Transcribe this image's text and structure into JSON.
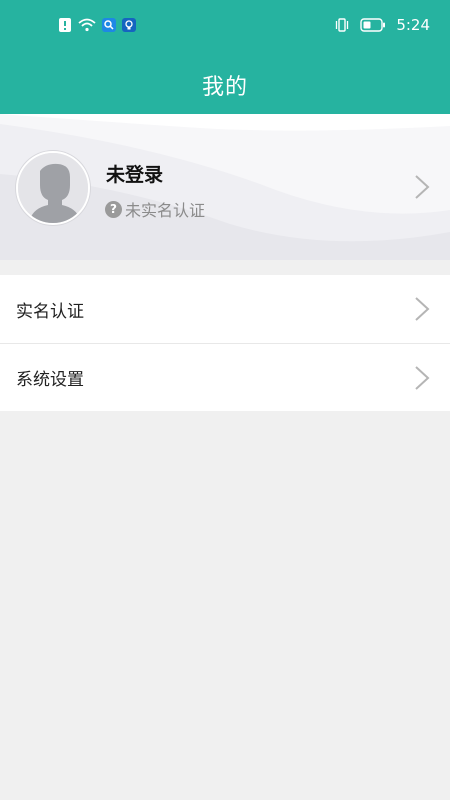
{
  "status_bar": {
    "time": "5:24",
    "left_icons": [
      "alert-icon",
      "wifi-icon",
      "search-app-icon",
      "bulb-app-icon"
    ],
    "right_icons": [
      "vibrate-icon",
      "battery-icon"
    ]
  },
  "header": {
    "title": "我的"
  },
  "profile": {
    "name": "未登录",
    "verify_status": "未实名认证",
    "verify_icon": "question-icon"
  },
  "menu": {
    "items": [
      {
        "label": "实名认证"
      },
      {
        "label": "系统设置"
      }
    ]
  },
  "colors": {
    "primary": "#26b3a0",
    "background": "#f0f0f0",
    "card": "#ffffff"
  }
}
